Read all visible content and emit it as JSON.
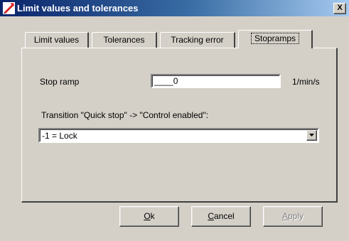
{
  "window": {
    "title": "Limit values and tolerances",
    "close_label": "X"
  },
  "tabs": [
    {
      "label": "Limit values",
      "active": false
    },
    {
      "label": "Tolerances",
      "active": false
    },
    {
      "label": "Tracking error",
      "active": false
    },
    {
      "label": "Stopramps",
      "active": true
    }
  ],
  "stopramps": {
    "stop_ramp_label": "Stop ramp",
    "stop_ramp_value": "____0",
    "stop_ramp_unit": "1/min/s",
    "transition_label": "Transition \"Quick stop\" -> \"Control enabled\":",
    "transition_selected": "-1 = Lock"
  },
  "buttons": {
    "ok_mnemonic": "O",
    "ok_rest": "k",
    "cancel_mnemonic": "C",
    "cancel_rest": "ancel",
    "apply_mnemonic": "A",
    "apply_rest": "pply",
    "apply_enabled": false
  },
  "colors": {
    "titlebar_start": "#0a246a",
    "titlebar_end": "#a6caf0",
    "face": "#d4d0c8"
  }
}
